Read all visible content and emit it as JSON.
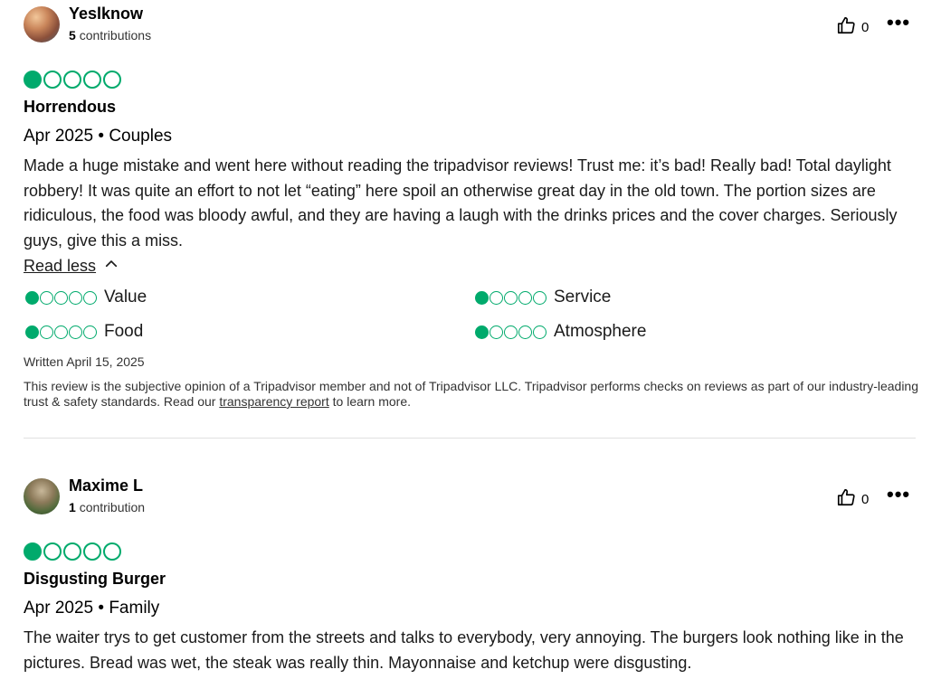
{
  "reviews": [
    {
      "username": "Yeslknow",
      "contributions_count": "5",
      "contributions_label": "contributions",
      "helpful_count": "0",
      "more_label": "•••",
      "rating": 1,
      "title": "Horrendous",
      "meta": "Apr 2025 • Couples",
      "body": "Made a huge mistake and went here without reading the tripadvisor reviews! Trust me: it’s bad! Really bad! Total daylight robbery! It was quite an effort to not let “eating” here spoil an otherwise great day in the old town. The portion sizes are ridiculous, the food was bloody awful, and they are having a laugh with the drinks prices and the cover charges. Seriously guys, give this a miss.",
      "read_less_label": "Read less",
      "subratings": [
        {
          "label": "Value",
          "rating": 1
        },
        {
          "label": "Service",
          "rating": 1
        },
        {
          "label": "Food",
          "rating": 1
        },
        {
          "label": "Atmosphere",
          "rating": 1
        }
      ],
      "written": "Written April 15, 2025",
      "disclaimer_before": "This review is the subjective opinion of a Tripadvisor member and not of Tripadvisor LLC. Tripadvisor performs checks on reviews as part of our industry-leading trust & safety standards. Read our ",
      "disclaimer_link": "transparency report",
      "disclaimer_after": " to learn more."
    },
    {
      "username": "Maxime L",
      "contributions_count": "1",
      "contributions_label": "contribution",
      "helpful_count": "0",
      "more_label": "•••",
      "rating": 1,
      "title": "Disgusting Burger",
      "meta": "Apr 2025 • Family",
      "body": "The waiter trys to get customer from the streets and talks to everybody, very annoying. The burgers look nothing like in the pictures. Bread was wet, the steak was really thin. Mayonnaise and ketchup were disgusting."
    }
  ],
  "colors": {
    "bubble_green": "#00aa6c",
    "divider": "#e0e0e0"
  },
  "icons": {
    "helpful": "thumbs-up-icon",
    "more": "more-options-icon",
    "read_less": "chevron-up-icon"
  }
}
